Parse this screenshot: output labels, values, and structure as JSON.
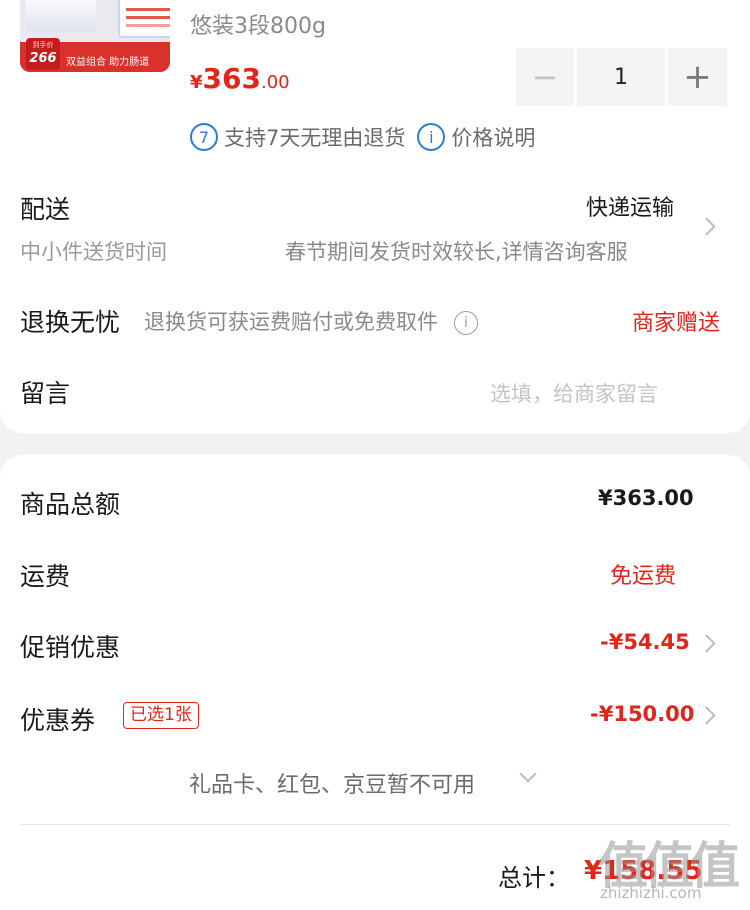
{
  "product": {
    "thumbnail": {
      "badge_prefix": "到手价",
      "badge_price": "266",
      "slogan": "双益组合 助力肠道"
    },
    "spec": "悠装3段800g",
    "price": {
      "currency": "¥",
      "integer": "363",
      "decimal": ".00"
    },
    "quantity": {
      "minus": "−",
      "value": "1",
      "plus": "+"
    },
    "tags": [
      {
        "icon": "7",
        "text": "支持7天无理由退货"
      },
      {
        "icon": "i",
        "text": "价格说明"
      }
    ]
  },
  "delivery": {
    "label": "配送",
    "method": "快递运输",
    "subtitle": "中小件送货时间",
    "note": "春节期间发货时效较长,详情咨询客服"
  },
  "return": {
    "label": "退换无忧",
    "desc": "退换货可获运费赔付或免费取件",
    "info_icon": "i",
    "value": "商家赠送"
  },
  "message": {
    "label": "留言",
    "placeholder": "选填，给商家留言"
  },
  "summary": {
    "total_goods_label": "商品总额",
    "total_goods_value": "¥363.00",
    "shipping_label": "运费",
    "shipping_value": "免运费",
    "promo_label": "促销优惠",
    "promo_value": "-¥54.45",
    "coupon_label": "优惠券",
    "coupon_tag": "已选1张",
    "coupon_value": "-¥150.00",
    "giftcard_note": "礼品卡、红包、京豆暂不可用",
    "grand_total_label": "总计：",
    "grand_total_value": "¥158.55"
  },
  "watermark": {
    "glyphs": "值值值",
    "site": "zhizhizhi.com"
  },
  "colors": {
    "accent_red": "#e1251b",
    "link_blue": "#2b7bd8"
  }
}
